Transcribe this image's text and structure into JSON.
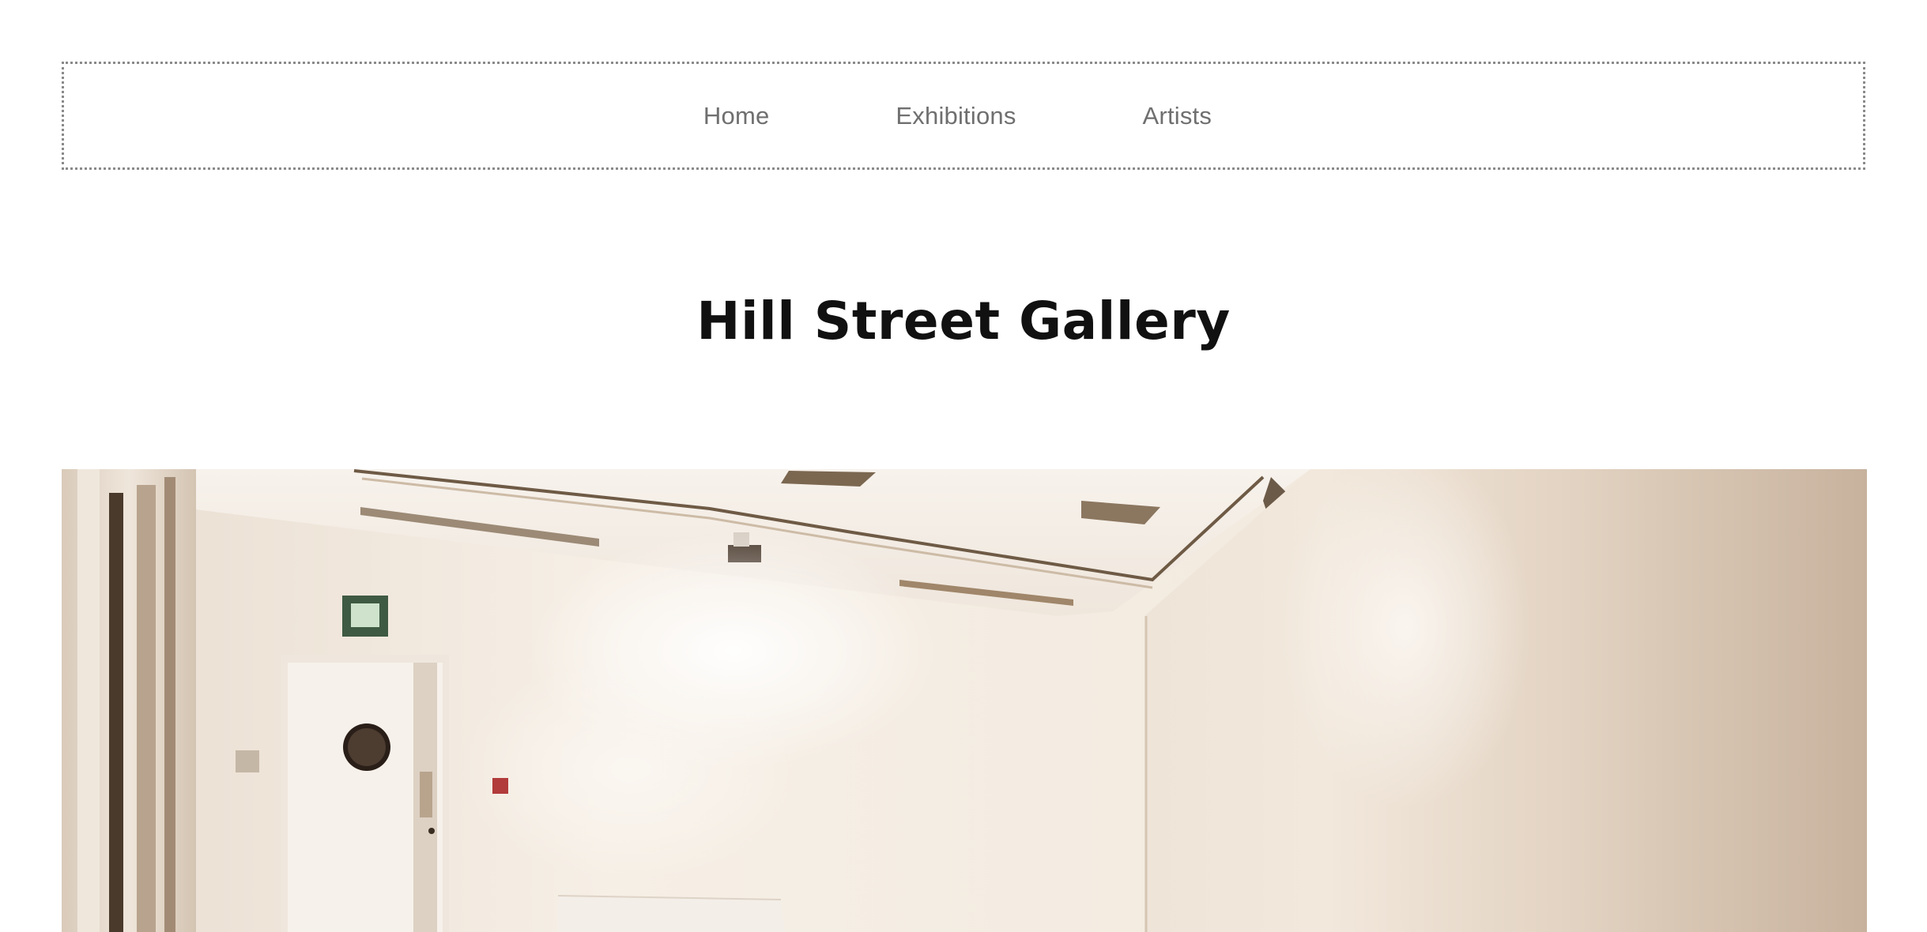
{
  "nav": {
    "items": [
      {
        "label": "Home"
      },
      {
        "label": "Exhibitions"
      },
      {
        "label": "Artists"
      }
    ]
  },
  "header": {
    "title": "Hill Street Gallery"
  },
  "colors": {
    "background": "#ffffff",
    "nav_text": "#6f6f6f",
    "nav_border": "#8a8a8a",
    "title_text": "#111111"
  }
}
